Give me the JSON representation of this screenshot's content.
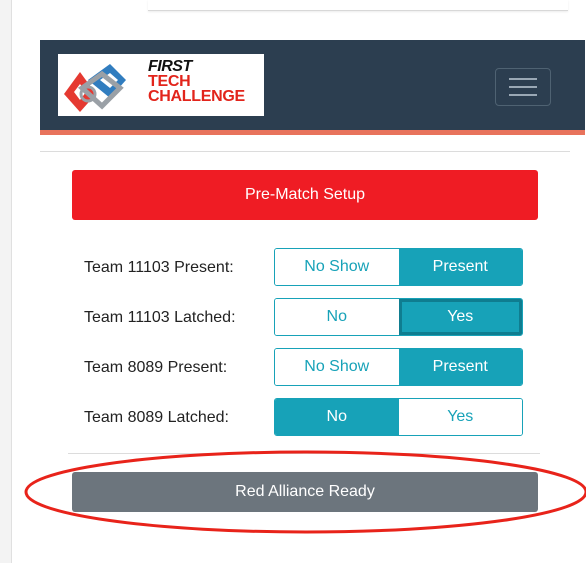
{
  "logo": {
    "first": "FIRST",
    "tech": "TECH",
    "challenge": "CHALLENGE"
  },
  "colors": {
    "navbar": "#2c3e50",
    "navbar_accent": "#e8735c",
    "prematch": "#ef1c24",
    "toggle": "#17a2b8",
    "ready": "#6c757d",
    "annotation": "#e8231a"
  },
  "icons": {
    "menu": "hamburger-menu-icon"
  },
  "prematch_button": "Pre-Match Setup",
  "rows": [
    {
      "label": "Team 11103 Present:",
      "options": [
        "No Show",
        "Present"
      ],
      "selected": "Present"
    },
    {
      "label": "Team 11103 Latched:",
      "options": [
        "No",
        "Yes"
      ],
      "selected": "Yes"
    },
    {
      "label": "Team 8089 Present:",
      "options": [
        "No Show",
        "Present"
      ],
      "selected": "Present"
    },
    {
      "label": "Team 8089 Latched:",
      "options": [
        "No",
        "Yes"
      ],
      "selected": "No"
    }
  ],
  "ready_button": "Red Alliance Ready"
}
